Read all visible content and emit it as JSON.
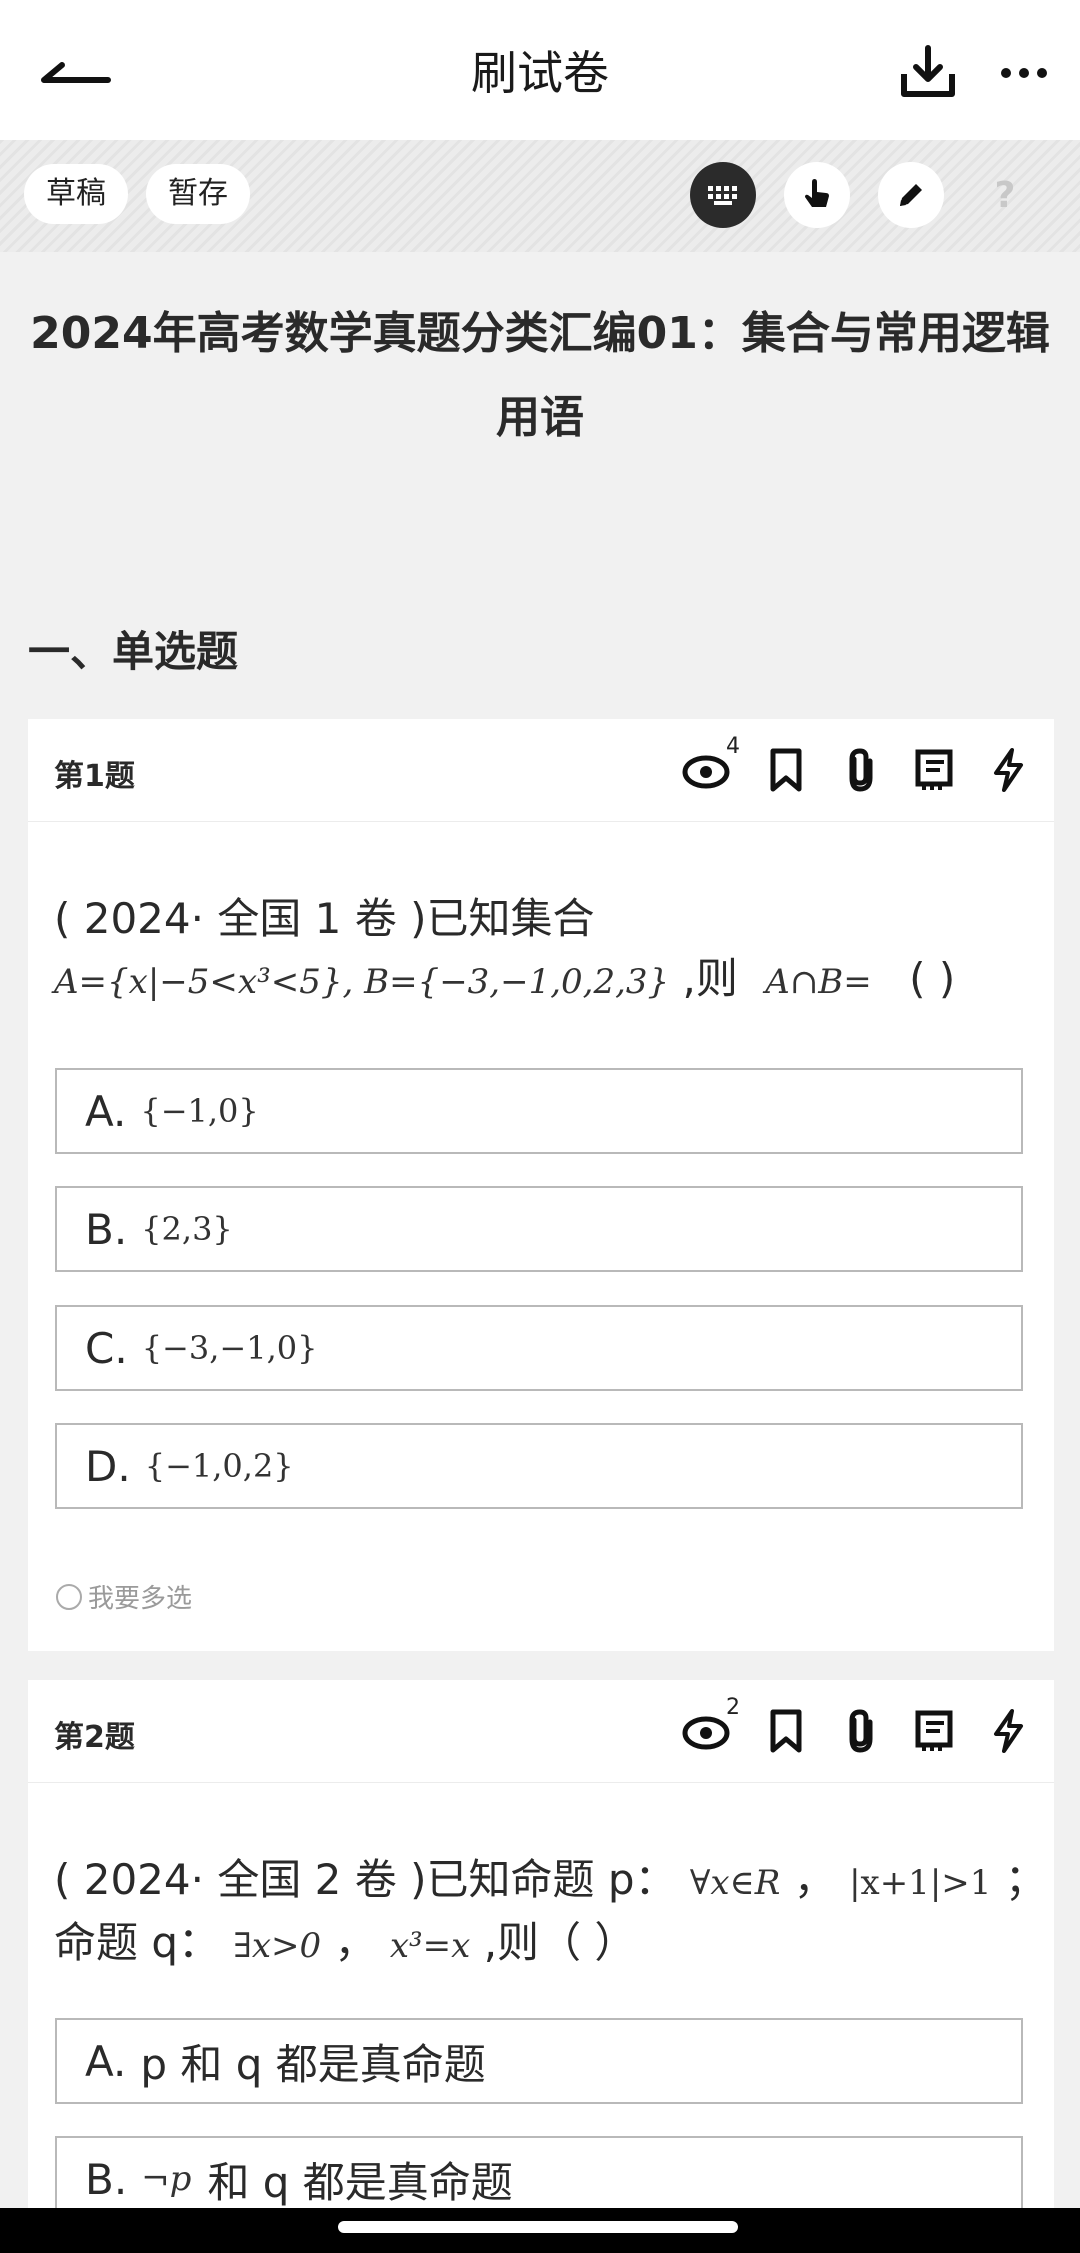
{
  "header": {
    "title": "刷试卷"
  },
  "toolbar": {
    "draft_label": "草稿",
    "save_label": "暂存",
    "help_label": "?"
  },
  "paper_title": "2024年高考数学真题分类汇编01：集合与常用逻辑用语",
  "section_title": "一、单选题",
  "questions": [
    {
      "number_label": "第1题",
      "view_count": "4",
      "stem_text": "( 2024· 全国 1 卷 )已知集合",
      "stem_math": "A={x|−5<x³<5}, B={−3,−1,0,2,3}",
      "stem_suffix": ",则",
      "stem_math2": "A∩B=",
      "stem_blank": "(     )",
      "options": [
        {
          "letter": "A.",
          "value": "{−1,0}"
        },
        {
          "letter": "B.",
          "value": "{2,3}"
        },
        {
          "letter": "C.",
          "value": "{−3,−1,0}"
        },
        {
          "letter": "D.",
          "value": "{−1,0,2}"
        }
      ],
      "multi_select_label": "我要多选"
    },
    {
      "number_label": "第2题",
      "view_count": "2",
      "stem_line1_text": "( 2024· 全国 2 卷 )已知命题 p：",
      "stem_line1_math": "∀x∈R",
      "stem_line1_sep": "，",
      "stem_line1_math2": "|x+1|>1",
      "stem_line1_end": "；",
      "stem_line2_text": "命题 q：",
      "stem_line2_math": "∃x>0",
      "stem_line2_sep": "，",
      "stem_line2_math2": "x³=x",
      "stem_line2_end": ",则（ ）",
      "options": [
        {
          "letter": "A.",
          "text": "p 和 q 都是真命题"
        },
        {
          "letter": "B.",
          "math": "¬p",
          "text": "和 q 都是真命题"
        }
      ]
    }
  ],
  "icons": [
    "back-arrow-icon",
    "download-icon",
    "more-icon",
    "keyboard-icon",
    "tap-icon",
    "pencil-icon",
    "help-icon",
    "eye-icon",
    "bookmark-icon",
    "paperclip-icon",
    "notebook-icon",
    "lightning-icon"
  ]
}
